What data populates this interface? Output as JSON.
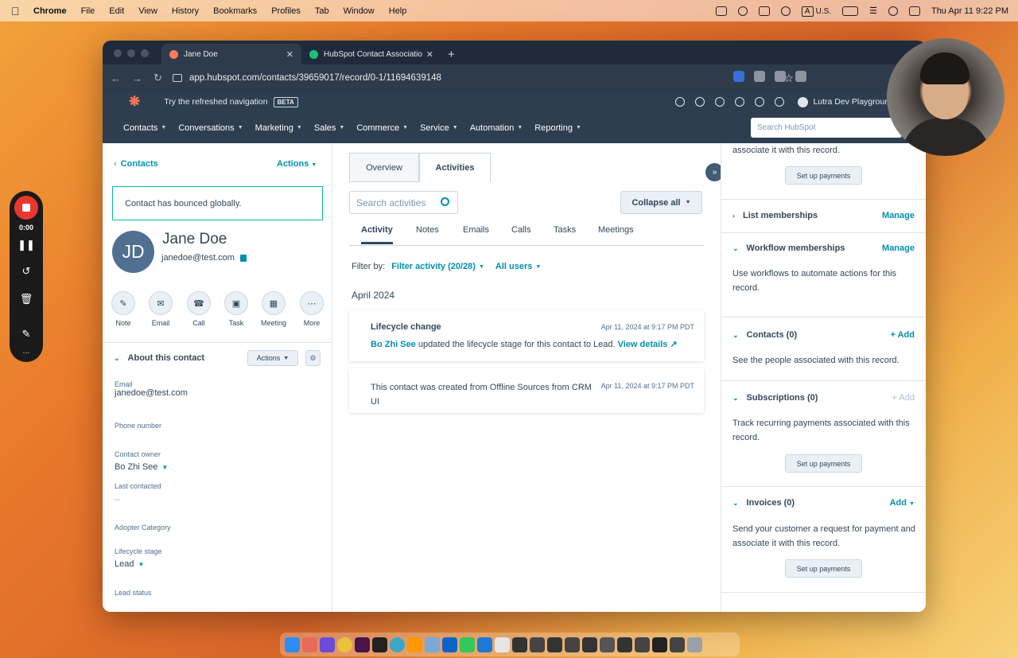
{
  "menubar": {
    "app": "Chrome",
    "items": [
      "File",
      "Edit",
      "View",
      "History",
      "Bookmarks",
      "Profiles",
      "Tab",
      "Window",
      "Help"
    ],
    "input_source": "A",
    "input_label": "U.S.",
    "datetime": "Thu Apr 11  9:22 PM"
  },
  "browser": {
    "tabs": [
      {
        "title": "Jane Doe",
        "active": true
      },
      {
        "title": "HubSpot Contact Associatio",
        "active": false
      }
    ],
    "new_tab": "+",
    "url": "app.hubspot.com/contacts/39659017/record/0-1/11694639148",
    "colors": {
      "tabbar": "#1f2b3a",
      "toolbar": "#2e3b4b"
    }
  },
  "hubspot_top": {
    "try_text": "Try the refreshed navigation",
    "beta": "BETA",
    "account": "Lutra Dev Playground"
  },
  "hubspot_nav": {
    "items": [
      "Contacts",
      "Conversations",
      "Marketing",
      "Sales",
      "Commerce",
      "Service",
      "Automation",
      "Reporting"
    ],
    "search_placeholder": "Search HubSpot",
    "colors": {
      "nav_bg": "#2d3e50",
      "brand": "#ff7a59"
    }
  },
  "left": {
    "breadcrumb": "Contacts",
    "actions": "Actions",
    "bounce_notice": "Contact has bounced globally.",
    "avatar_initials": "JD",
    "name": "Jane Doe",
    "email": "janedoe@test.com",
    "quick_actions": [
      {
        "label": "Note",
        "icon": "note-icon"
      },
      {
        "label": "Email",
        "icon": "email-icon"
      },
      {
        "label": "Call",
        "icon": "phone-icon"
      },
      {
        "label": "Task",
        "icon": "task-icon"
      },
      {
        "label": "Meeting",
        "icon": "calendar-icon"
      },
      {
        "label": "More",
        "icon": "more-icon"
      }
    ],
    "about_title": "About this contact",
    "about_actions": "Actions",
    "properties": {
      "email_label": "Email",
      "email_value": "janedoe@test.com",
      "phone_label": "Phone number",
      "owner_label": "Contact owner",
      "owner_value": "Bo Zhi See",
      "last_contacted_label": "Last contacted",
      "last_contacted_value": "--",
      "adopter_label": "Adopter Category",
      "stage_label": "Lifecycle stage",
      "stage_value": "Lead",
      "lead_status_label": "Lead status"
    }
  },
  "middle": {
    "tabs": [
      "Overview",
      "Activities"
    ],
    "active_tab": "Activities",
    "search_placeholder": "Search activities",
    "collapse_all": "Collapse all",
    "subtabs": [
      "Activity",
      "Notes",
      "Emails",
      "Calls",
      "Tasks",
      "Meetings"
    ],
    "filter_label": "Filter by:",
    "filter_activity": "Filter activity (20/28)",
    "all_users": "All users",
    "month": "April 2024",
    "activities": [
      {
        "title": "Lifecycle change",
        "timestamp": "Apr 11, 2024 at 9:17 PM PDT",
        "actor": "Bo Zhi See",
        "text": "updated the lifecycle stage for this contact to Lead.",
        "link": "View details"
      },
      {
        "text": "This contact was created from Offline Sources from CRM UI",
        "timestamp": "Apr 11, 2024 at 9:17 PM PDT"
      }
    ]
  },
  "right": {
    "top_text": "associate it with this record.",
    "setup_payments": "Set up payments",
    "sections": {
      "list": {
        "title": "List memberships",
        "action": "Manage"
      },
      "workflow": {
        "title": "Workflow memberships",
        "action": "Manage",
        "desc": "Use workflows to automate actions for this record."
      },
      "contacts": {
        "title": "Contacts (0)",
        "action": "+ Add",
        "desc": "See the people associated with this record."
      },
      "subscriptions": {
        "title": "Subscriptions (0)",
        "action": "+ Add",
        "desc": "Track recurring payments associated with this record."
      },
      "invoices": {
        "title": "Invoices (0)",
        "action": "Add",
        "desc": "Send your customer a request for payment and associate it with this record."
      }
    }
  },
  "recorder": {
    "time": "0:00"
  },
  "icons": [
    "apple-icon",
    "wifi-icon",
    "battery-icon",
    "search-icon",
    "close-icon",
    "expand-icon",
    "gear-icon",
    "chevron-down-icon",
    "copy-icon",
    "external-link-icon"
  ]
}
